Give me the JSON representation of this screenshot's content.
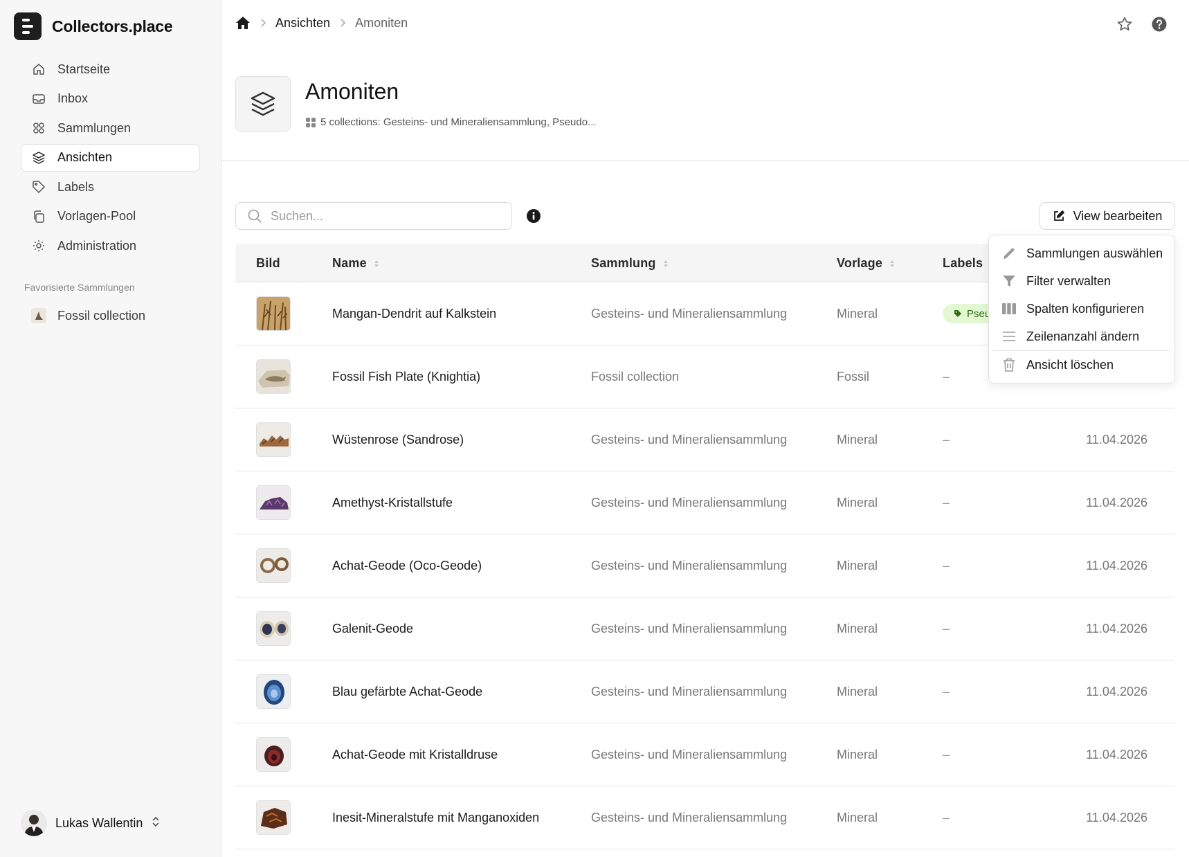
{
  "app": {
    "name": "Collectors.place"
  },
  "sidebar": {
    "items": [
      {
        "label": "Startseite",
        "icon": "home-icon"
      },
      {
        "label": "Inbox",
        "icon": "inbox-icon"
      },
      {
        "label": "Sammlungen",
        "icon": "grid-icon"
      },
      {
        "label": "Ansichten",
        "icon": "layers-icon",
        "active": true
      },
      {
        "label": "Labels",
        "icon": "tag-icon"
      },
      {
        "label": "Vorlagen-Pool",
        "icon": "copy-icon"
      },
      {
        "label": "Administration",
        "icon": "gear-icon"
      }
    ],
    "favorites_heading": "Favorisierte Sammlungen",
    "favorites": [
      {
        "label": "Fossil collection"
      }
    ]
  },
  "user": {
    "name": "Lukas Wallentin"
  },
  "breadcrumb": {
    "items": [
      "Ansichten",
      "Amoniten"
    ]
  },
  "page": {
    "title": "Amoniten",
    "subtitle": "5 collections: Gesteins- und Mineraliensammlung, Pseudo..."
  },
  "search": {
    "placeholder": "Suchen...",
    "value": ""
  },
  "toolbar": {
    "edit_label": "View bearbeiten"
  },
  "table": {
    "columns": {
      "image": "Bild",
      "name": "Name",
      "collection": "Sammlung",
      "template": "Vorlage",
      "labels": "Labels"
    },
    "rows": [
      {
        "name": "Mangan-Dendrit auf Kalkstein",
        "collection": "Gesteins- und Mineraliensammlung",
        "template": "Mineral",
        "label": "Pseu",
        "date": ""
      },
      {
        "name": "Fossil Fish Plate (Knightia)",
        "collection": "Fossil collection",
        "template": "Fossil",
        "label": "–",
        "date": ""
      },
      {
        "name": "Wüstenrose (Sandrose)",
        "collection": "Gesteins- und Mineraliensammlung",
        "template": "Mineral",
        "label": "–",
        "date": "11.04.2026"
      },
      {
        "name": "Amethyst-Kristallstufe",
        "collection": "Gesteins- und Mineraliensammlung",
        "template": "Mineral",
        "label": "–",
        "date": "11.04.2026"
      },
      {
        "name": "Achat-Geode (Oco-Geode)",
        "collection": "Gesteins- und Mineraliensammlung",
        "template": "Mineral",
        "label": "–",
        "date": "11.04.2026"
      },
      {
        "name": "Galenit-Geode",
        "collection": "Gesteins- und Mineraliensammlung",
        "template": "Mineral",
        "label": "–",
        "date": "11.04.2026"
      },
      {
        "name": "Blau gefärbte Achat-Geode",
        "collection": "Gesteins- und Mineraliensammlung",
        "template": "Mineral",
        "label": "–",
        "date": "11.04.2026"
      },
      {
        "name": "Achat-Geode mit Kristalldruse",
        "collection": "Gesteins- und Mineraliensammlung",
        "template": "Mineral",
        "label": "–",
        "date": "11.04.2026"
      },
      {
        "name": "Inesit-Mineralstufe mit Manganoxiden",
        "collection": "Gesteins- und Mineraliensammlung",
        "template": "Mineral",
        "label": "–",
        "date": "11.04.2026"
      }
    ]
  },
  "menu": {
    "items": [
      {
        "label": "Sammlungen auswählen",
        "icon": "pencil-icon"
      },
      {
        "label": "Filter verwalten",
        "icon": "funnel-icon"
      },
      {
        "label": "Spalten konfigurieren",
        "icon": "columns-icon"
      },
      {
        "label": "Zeilenanzahl ändern",
        "icon": "rows-icon"
      },
      {
        "label": "Ansicht löschen",
        "icon": "trash-icon"
      }
    ]
  },
  "colors": {
    "accent": "#1e1e1e",
    "label_bg": "#e3f7d2",
    "label_text": "#2c6d14",
    "sidebar_bg": "#f7f7f7"
  }
}
